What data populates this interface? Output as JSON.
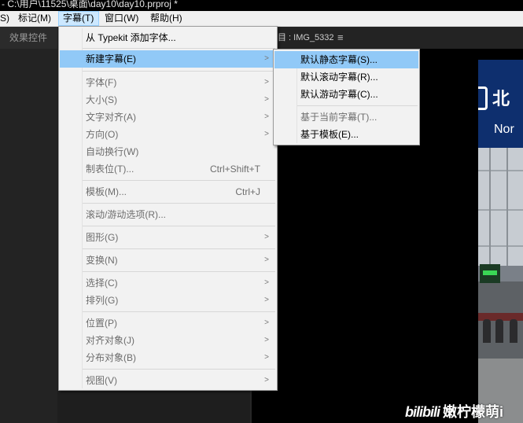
{
  "title_bar": {
    "text": "- C:\\用户\\11525\\桌面\\day10\\day10.prproj *"
  },
  "menubar": {
    "items": [
      {
        "label": "S)"
      },
      {
        "label": "标记(M)"
      },
      {
        "label": "字幕(T)"
      },
      {
        "label": "窗口(W)"
      },
      {
        "label": "帮助(H)"
      }
    ]
  },
  "left_panel": {
    "tab": "效果控件"
  },
  "program_tab": {
    "label": "目 : IMG_5332",
    "menu_glyph": "≡"
  },
  "main_menu": {
    "items": [
      {
        "label": "从 Typekit 添加字体...",
        "shortcut": "",
        "submenu": false,
        "enabled": true
      },
      {
        "label": "新建字幕(E)",
        "shortcut": "",
        "submenu": true,
        "enabled": true,
        "highlighted": true
      },
      {
        "label": "字体(F)",
        "shortcut": "",
        "submenu": true,
        "enabled": false
      },
      {
        "label": "大小(S)",
        "shortcut": "",
        "submenu": true,
        "enabled": false
      },
      {
        "label": "文字对齐(A)",
        "shortcut": "",
        "submenu": true,
        "enabled": false
      },
      {
        "label": "方向(O)",
        "shortcut": "",
        "submenu": true,
        "enabled": false
      },
      {
        "label": "自动换行(W)",
        "shortcut": "",
        "submenu": false,
        "enabled": false
      },
      {
        "label": "制表位(T)...",
        "shortcut": "Ctrl+Shift+T",
        "submenu": false,
        "enabled": false
      },
      {
        "label": "模板(M)...",
        "shortcut": "Ctrl+J",
        "submenu": false,
        "enabled": false
      },
      {
        "label": "滚动/游动选项(R)...",
        "shortcut": "",
        "submenu": false,
        "enabled": false
      },
      {
        "label": "图形(G)",
        "shortcut": "",
        "submenu": true,
        "enabled": false
      },
      {
        "label": "变换(N)",
        "shortcut": "",
        "submenu": true,
        "enabled": false
      },
      {
        "label": "选择(C)",
        "shortcut": "",
        "submenu": true,
        "enabled": false
      },
      {
        "label": "排列(G)",
        "shortcut": "",
        "submenu": true,
        "enabled": false
      },
      {
        "label": "位置(P)",
        "shortcut": "",
        "submenu": true,
        "enabled": false
      },
      {
        "label": "对齐对象(J)",
        "shortcut": "",
        "submenu": true,
        "enabled": false
      },
      {
        "label": "分布对象(B)",
        "shortcut": "",
        "submenu": true,
        "enabled": false
      },
      {
        "label": "视图(V)",
        "shortcut": "",
        "submenu": true,
        "enabled": false
      }
    ]
  },
  "sub_menu": {
    "items": [
      {
        "label": "默认静态字幕(S)...",
        "enabled": true,
        "highlighted": true
      },
      {
        "label": "默认滚动字幕(R)...",
        "enabled": true
      },
      {
        "label": "默认游动字幕(C)...",
        "enabled": true
      },
      {
        "label": "基于当前字幕(T)...",
        "enabled": false
      },
      {
        "label": "基于模板(E)...",
        "enabled": true
      }
    ]
  },
  "video": {
    "sign_text_1": "北",
    "sign_text_2": "Nor"
  },
  "watermark": {
    "logo": "bilibili",
    "text": "嫩柠檬萌i"
  },
  "colors": {
    "menu_highlight": "#91c9f7",
    "menubar_active": "#cce8ff",
    "sign_blue": "#0e2f6e"
  }
}
